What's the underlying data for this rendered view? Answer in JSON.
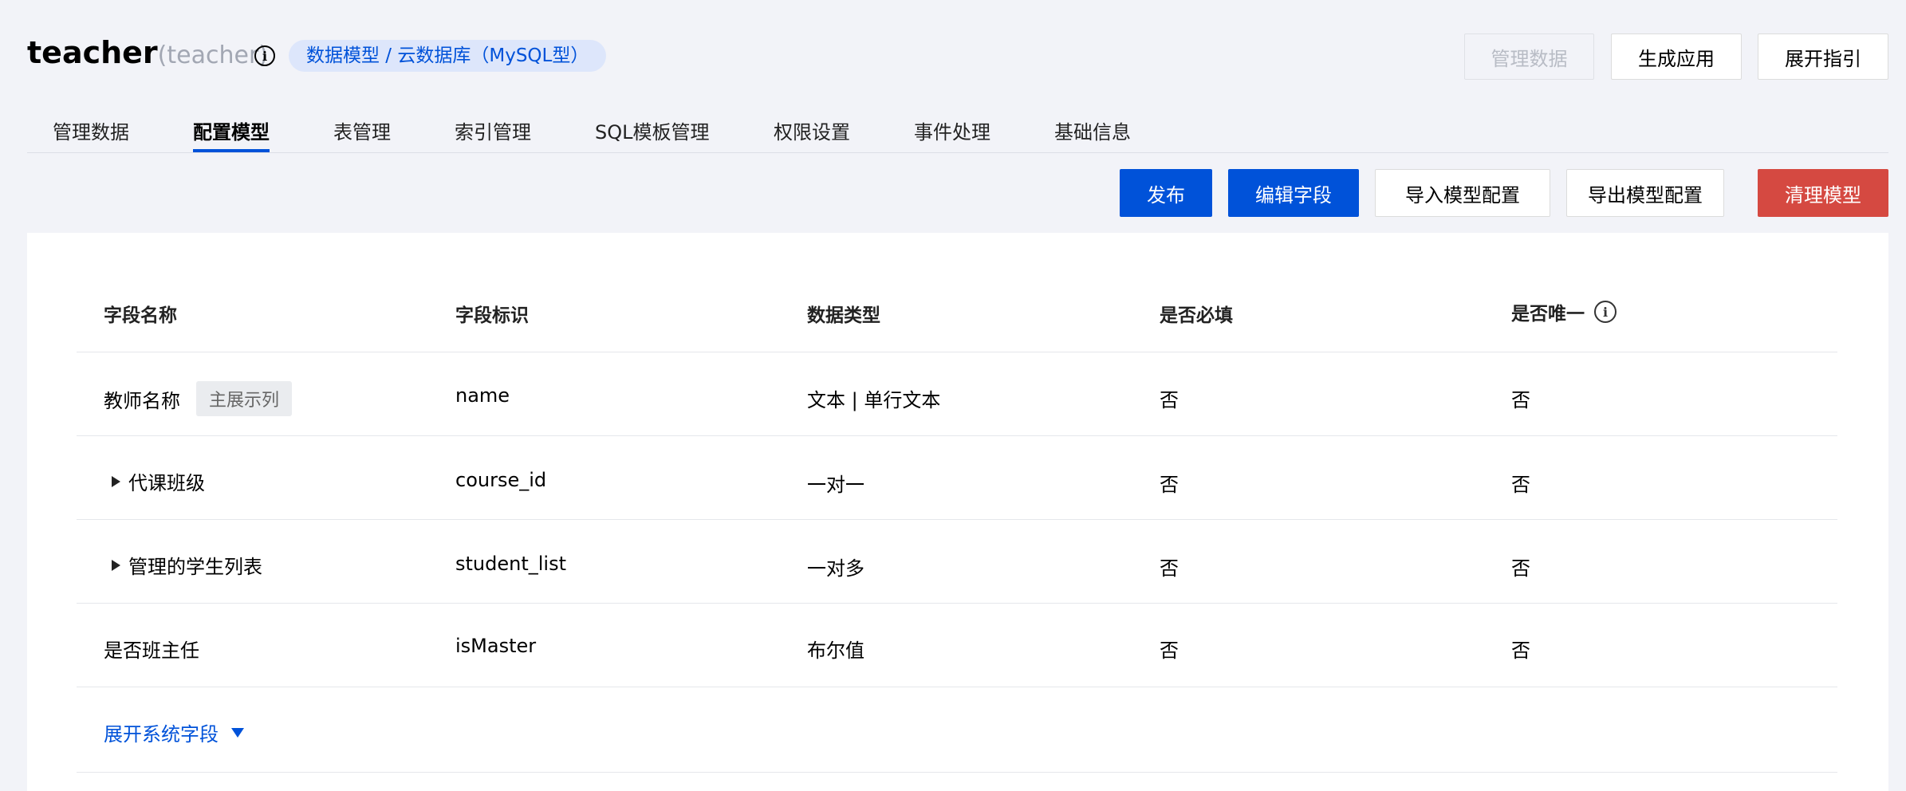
{
  "header": {
    "title": "teacher",
    "subtitle": "(teacher)",
    "badge": "数据模型 / 云数据库（MySQL型）",
    "buttons": {
      "manage_data": "管理数据",
      "generate_app": "生成应用",
      "expand_guide": "展开指引"
    }
  },
  "tabs": [
    {
      "label": "管理数据"
    },
    {
      "label": "配置模型",
      "active": true
    },
    {
      "label": "表管理"
    },
    {
      "label": "索引管理"
    },
    {
      "label": "SQL模板管理"
    },
    {
      "label": "权限设置"
    },
    {
      "label": "事件处理"
    },
    {
      "label": "基础信息"
    }
  ],
  "actions": {
    "publish": "发布",
    "edit_fields": "编辑字段",
    "import_config": "导入模型配置",
    "export_config": "导出模型配置",
    "clear_model": "清理模型"
  },
  "table": {
    "columns": [
      "字段名称",
      "字段标识",
      "数据类型",
      "是否必填",
      "是否唯一"
    ],
    "rows": [
      {
        "name": "教师名称",
        "tag": "主展示列",
        "id": "name",
        "type": "文本 | 单行文本",
        "required": "否",
        "unique": "否"
      },
      {
        "name": "代课班级",
        "expandable": true,
        "id": "course_id",
        "type": "一对一",
        "required": "否",
        "unique": "否"
      },
      {
        "name": "管理的学生列表",
        "expandable": true,
        "id": "student_list",
        "type": "一对多",
        "required": "否",
        "unique": "否"
      },
      {
        "name": "是否班主任",
        "id": "isMaster",
        "type": "布尔值",
        "required": "否",
        "unique": "否"
      }
    ],
    "expand_system_fields": "展开系统字段"
  },
  "colors": {
    "primary": "#0052d9",
    "danger": "#d54941",
    "background": "#f2f3f8"
  }
}
